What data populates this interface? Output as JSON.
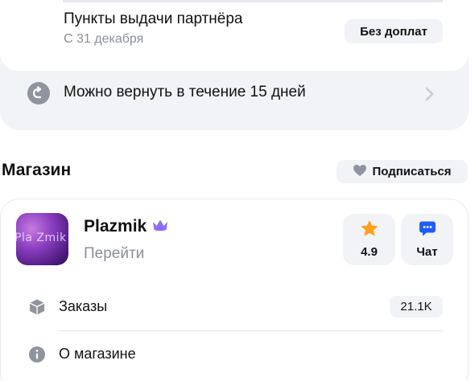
{
  "delivery": {
    "pickup_title": "Пункты выдачи партнёра",
    "pickup_date": "С 31 декабря",
    "pickup_badge": "Без доплат"
  },
  "returns": {
    "text": "Можно вернуть в течение 15 дней",
    "icon": "return-arrow-icon"
  },
  "shop_section": {
    "heading": "Магазин",
    "subscribe_label": "Подписаться"
  },
  "shop": {
    "name": "Plazmik",
    "logo_text": "Pla Zmik",
    "go_label": "Перейти",
    "rating": "4.9",
    "chat_label": "Чат",
    "orders_label": "Заказы",
    "orders_count": "21.1K",
    "about_label": "О магазине"
  },
  "colors": {
    "accent_star": "#ff9f1a",
    "chat_blue": "#1f5cff",
    "crown_purple": "#7b4dff",
    "muted_text": "#8b8f99",
    "panel_bg": "#f2f3f6"
  }
}
